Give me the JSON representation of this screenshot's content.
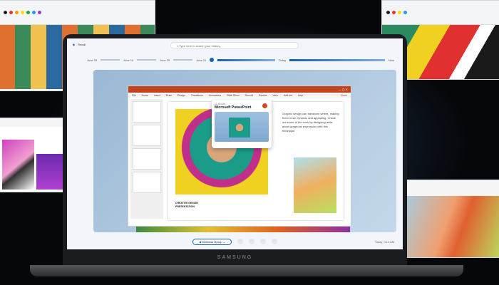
{
  "device": {
    "brand": "SAMSUNG"
  },
  "recall": {
    "app_title": "Recall",
    "search_placeholder": "Type here to search your history",
    "timeline": {
      "start": "June 18",
      "labels": [
        "June 19",
        "June 20",
        "June 21",
        "Today"
      ],
      "now_label": "Now",
      "position_percent": 42
    },
    "popup": {
      "time": "11:45 AM",
      "app": "Microsoft PowerPoint"
    },
    "bottom": {
      "app_pill": "Wellness Group",
      "timestamp": "Today, 9:14 AM"
    }
  },
  "powerpoint": {
    "menu": [
      "File",
      "Home",
      "Insert",
      "Draw",
      "Design",
      "Transitions",
      "Animations",
      "Slide Show",
      "Record",
      "Review",
      "View",
      "Add-ins",
      "Help"
    ],
    "share": "Share",
    "slide_text": "Graphic design can transform where, making them more dynamic and appealing. Check out some of the work by designing artist about gorgeous expression with this technique.",
    "slide_title": "CREATIVE DESIGN PRESENTATION"
  },
  "colors": {
    "accent": "#1a5fb4",
    "ppt": "#c4431f"
  }
}
